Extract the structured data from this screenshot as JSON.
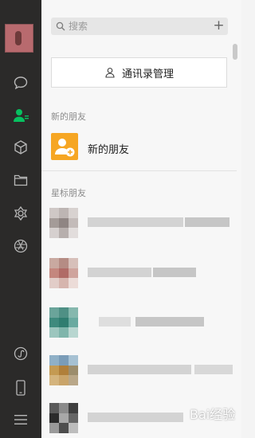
{
  "sidebar": {
    "nav": [
      {
        "name": "chat-icon"
      },
      {
        "name": "contacts-icon",
        "active": true
      },
      {
        "name": "favorites-icon"
      },
      {
        "name": "files-icon"
      },
      {
        "name": "moments-icon"
      },
      {
        "name": "aperture-icon"
      },
      {
        "name": "mini-program-icon"
      },
      {
        "name": "phone-icon"
      },
      {
        "name": "menu-icon"
      }
    ]
  },
  "search": {
    "placeholder": "搜索"
  },
  "add_button": {
    "label": "+"
  },
  "manage": {
    "label": "通讯录管理"
  },
  "sections": {
    "new_friends_header": "新的朋友",
    "starred_header": "星标朋友"
  },
  "new_friend_item": {
    "label": "新的朋友"
  },
  "colors": {
    "sidebar_bg": "#2b2a29",
    "active_green": "#07c160",
    "new_friend_orange": "#f6a623"
  },
  "watermark": "Bai经验"
}
